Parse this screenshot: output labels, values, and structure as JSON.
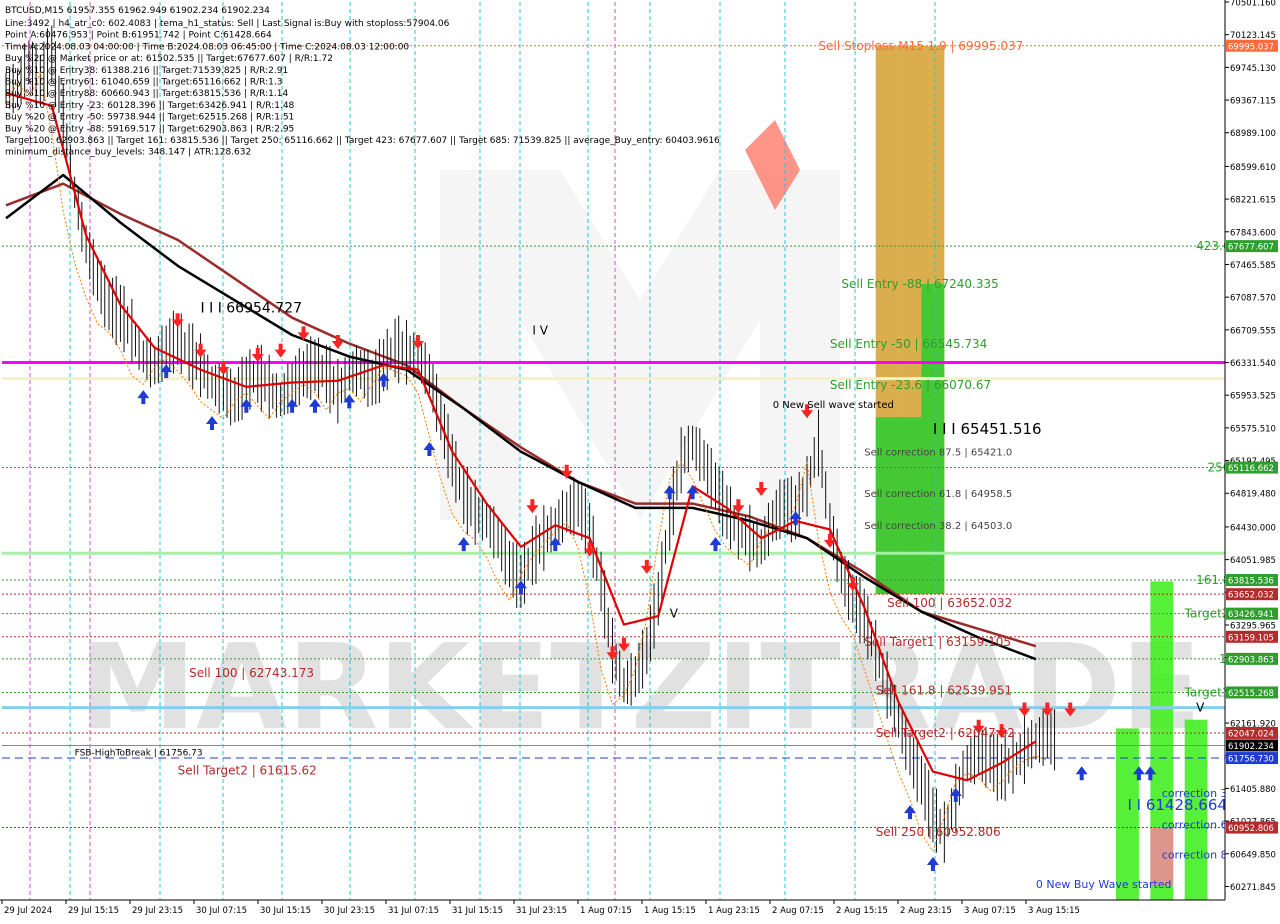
{
  "chart_data": {
    "type": "line",
    "title": "BTCUSD,M15  61957.355 61962.949 61902.234 61902.234",
    "ylim": [
      60115,
      70501.16
    ],
    "info_lines": [
      "Line:3492 | h4_atr_c0: 602.4083 | tema_h1_status: Sell | Last Signal is:Buy with stoploss:57904.06",
      "Point A:60476.953 | Point B:61951.742 | Point C:61428.664",
      "Time A:2024.08.03 04:00:00 | Time B:2024.08.03 06:45:00 | Time C:2024.08.03 12:00:00",
      "Buy %20 @ Market price or at: 61502.535 || Target:67677.607 | R/R:1.72",
      "Buy %10 @ Entry38: 61388.216 || Target:71539.825 | R/R:2.91",
      "Buy %10 @ Entry61: 61040.659 || Target:65116.662 | R/R:1.3",
      "Buy %10 @ Entry88: 60660.943 || Target:63815.536 | R/R:1.14",
      "Buy %10 @ Entry -23: 60128.396 || Target:63426.941 | R/R:1.48",
      "Buy %20 @ Entry -50: 59738.944 || Target:62515.268 | R/R:1.51",
      "Buy %20 @ Entry -88: 59169.517 || Target:62903.863 | R/R:2.95",
      "Target100: 62903.863 || Target 161: 63815.536 || Target 250: 65116.662 || Target 423: 67677.607 || Target 685: 71539.825 || average_Buy_entry: 60403.9616",
      "minimum_distance_buy_levels: 348.147 | ATR:128.632"
    ],
    "y_ticks": [
      "70501.160",
      "70123.145",
      "69745.130",
      "69367.115",
      "68989.100",
      "68599.610",
      "68221.615",
      "67843.600",
      "67465.585",
      "67087.570",
      "66709.555",
      "66331.540",
      "65953.525",
      "65575.510",
      "65197.495",
      "64819.480",
      "64430.000",
      "64051.985",
      "63673.970",
      "63295.965",
      "62917.940",
      "62539.925",
      "62161.920",
      "61783.895",
      "61405.880",
      "61027.865",
      "60649.850",
      "60271.845"
    ],
    "x_ticks": [
      "29 Jul 2024",
      "29 Jul 15:15",
      "29 Jul 23:15",
      "30 Jul 07:15",
      "30 Jul 15:15",
      "30 Jul 23:15",
      "31 Jul 07:15",
      "31 Jul 15:15",
      "31 Jul 23:15",
      "1 Aug 07:15",
      "1 Aug 15:15",
      "1 Aug 23:15",
      "2 Aug 07:15",
      "2 Aug 15:15",
      "2 Aug 23:15",
      "3 Aug 07:15",
      "3 Aug 15:15"
    ],
    "price_series": [
      [
        0,
        69500
      ],
      [
        1,
        69800
      ],
      [
        2,
        69600
      ],
      [
        3,
        69900
      ],
      [
        4,
        69200
      ],
      [
        5,
        68300
      ],
      [
        6,
        67700
      ],
      [
        7,
        67300
      ],
      [
        8,
        67000
      ],
      [
        9,
        66900
      ],
      [
        10,
        66700
      ],
      [
        11,
        66400
      ],
      [
        12,
        66300
      ],
      [
        13,
        66500
      ],
      [
        14,
        66600
      ],
      [
        15,
        66450
      ],
      [
        16,
        66300
      ],
      [
        17,
        66100
      ],
      [
        18,
        66000
      ],
      [
        19,
        65900
      ],
      [
        20,
        66100
      ],
      [
        21,
        66200
      ],
      [
        22,
        66050
      ],
      [
        23,
        65900
      ],
      [
        24,
        66100
      ],
      [
        25,
        66200
      ],
      [
        26,
        66300
      ],
      [
        27,
        66200
      ],
      [
        28,
        66000
      ],
      [
        29,
        66200
      ],
      [
        30,
        66250
      ],
      [
        31,
        66100
      ],
      [
        32,
        66300
      ],
      [
        33,
        66500
      ],
      [
        34,
        66450
      ],
      [
        35,
        66400
      ],
      [
        36,
        66200
      ],
      [
        37,
        65700
      ],
      [
        38,
        65200
      ],
      [
        39,
        64800
      ],
      [
        40,
        64600
      ],
      [
        41,
        64500
      ],
      [
        42,
        64300
      ],
      [
        43,
        64000
      ],
      [
        44,
        63800
      ],
      [
        45,
        64100
      ],
      [
        46,
        64300
      ],
      [
        47,
        64450
      ],
      [
        48,
        64600
      ],
      [
        49,
        64700
      ],
      [
        50,
        64400
      ],
      [
        51,
        63800
      ],
      [
        52,
        63000
      ],
      [
        53,
        62600
      ],
      [
        54,
        62700
      ],
      [
        55,
        63000
      ],
      [
        56,
        63600
      ],
      [
        57,
        64500
      ],
      [
        58,
        65200
      ],
      [
        59,
        65400
      ],
      [
        60,
        65200
      ],
      [
        61,
        64900
      ],
      [
        62,
        64600
      ],
      [
        63,
        64400
      ],
      [
        64,
        64300
      ],
      [
        65,
        64200
      ],
      [
        66,
        64500
      ],
      [
        67,
        64700
      ],
      [
        68,
        64600
      ],
      [
        69,
        64900
      ],
      [
        70,
        65400
      ],
      [
        71,
        64500
      ],
      [
        72,
        63900
      ],
      [
        73,
        63600
      ],
      [
        74,
        63400
      ],
      [
        75,
        63000
      ],
      [
        76,
        62600
      ],
      [
        77,
        62200
      ],
      [
        78,
        61800
      ],
      [
        79,
        61500
      ],
      [
        80,
        61100
      ],
      [
        81,
        60900
      ],
      [
        82,
        61300
      ],
      [
        83,
        61700
      ],
      [
        84,
        61800
      ],
      [
        85,
        61750
      ],
      [
        86,
        61600
      ],
      [
        87,
        61700
      ],
      [
        88,
        61850
      ],
      [
        89,
        61950
      ],
      [
        90,
        62000
      ],
      [
        91,
        61950
      ]
    ],
    "ma_fast": [
      [
        0,
        69450
      ],
      [
        4,
        69300
      ],
      [
        7,
        67800
      ],
      [
        10,
        67000
      ],
      [
        13,
        66500
      ],
      [
        17,
        66250
      ],
      [
        21,
        66050
      ],
      [
        25,
        66100
      ],
      [
        29,
        66120
      ],
      [
        33,
        66300
      ],
      [
        36,
        66250
      ],
      [
        39,
        65300
      ],
      [
        42,
        64700
      ],
      [
        45,
        64200
      ],
      [
        48,
        64450
      ],
      [
        51,
        64300
      ],
      [
        54,
        63300
      ],
      [
        57,
        63400
      ],
      [
        60,
        64900
      ],
      [
        63,
        64650
      ],
      [
        66,
        64300
      ],
      [
        69,
        64500
      ],
      [
        72,
        64400
      ],
      [
        75,
        63500
      ],
      [
        78,
        62400
      ],
      [
        81,
        61600
      ],
      [
        84,
        61500
      ],
      [
        87,
        61700
      ],
      [
        90,
        61950
      ]
    ],
    "ma_mid": [
      [
        0,
        68150
      ],
      [
        5,
        68400
      ],
      [
        10,
        68050
      ],
      [
        15,
        67750
      ],
      [
        20,
        67300
      ],
      [
        25,
        66850
      ],
      [
        30,
        66550
      ],
      [
        35,
        66300
      ],
      [
        40,
        65800
      ],
      [
        45,
        65350
      ],
      [
        50,
        64950
      ],
      [
        55,
        64700
      ],
      [
        60,
        64700
      ],
      [
        65,
        64550
      ],
      [
        70,
        64300
      ],
      [
        75,
        63900
      ],
      [
        80,
        63450
      ],
      [
        85,
        63250
      ],
      [
        90,
        63050
      ]
    ],
    "ma_slow": [
      [
        0,
        68000
      ],
      [
        5,
        68500
      ],
      [
        10,
        67950
      ],
      [
        15,
        67450
      ],
      [
        20,
        67050
      ],
      [
        25,
        66650
      ],
      [
        30,
        66400
      ],
      [
        35,
        66250
      ],
      [
        40,
        65800
      ],
      [
        45,
        65300
      ],
      [
        50,
        64950
      ],
      [
        55,
        64650
      ],
      [
        60,
        64650
      ],
      [
        65,
        64500
      ],
      [
        70,
        64300
      ],
      [
        75,
        63850
      ],
      [
        80,
        63450
      ],
      [
        85,
        63150
      ],
      [
        90,
        62900
      ]
    ],
    "horizontal_levels": [
      {
        "price": 69995.037,
        "label": "69995.037",
        "bg": "#ff6a3d",
        "style": "dotted",
        "color": "#ff6a3d"
      },
      {
        "price": 67677.607,
        "label": "67677.607",
        "bg": "#2e9e2e",
        "style": "dotted",
        "color": "#2e9e2e"
      },
      {
        "price": 66331.54,
        "label": "",
        "bg": "",
        "style": "solid",
        "color": "#ff00ff",
        "width": 3
      },
      {
        "price": 66145.0,
        "label": "",
        "bg": "",
        "style": "solid",
        "color": "#f3f0cc",
        "width": 3
      },
      {
        "price": 65116.662,
        "label": "65116.662",
        "bg": "#2e9e2e",
        "style": "dotted",
        "color": "#2e9e2e"
      },
      {
        "price": 64125.0,
        "label": "",
        "bg": "",
        "style": "solid",
        "color": "#a5f0a5",
        "width": 3
      },
      {
        "price": 63815.536,
        "label": "63815.536",
        "bg": "#2e9e2e",
        "style": "dotted",
        "color": "#2e9e2e"
      },
      {
        "price": 63652.032,
        "label": "63652.032",
        "bg": "#b52a2a",
        "style": "dotted",
        "color": "#b52a2a"
      },
      {
        "price": 63426.941,
        "label": "63426.941",
        "bg": "#2e9e2e",
        "style": "dotted",
        "color": "#2e9e2e"
      },
      {
        "price": 63159.105,
        "label": "63159.105",
        "bg": "#b52a2a",
        "style": "dotted",
        "color": "#b52a2a"
      },
      {
        "price": 62903.863,
        "label": "62903.863",
        "bg": "#2e9e2e",
        "style": "dotted",
        "color": "#2e9e2e"
      },
      {
        "price": 62515.268,
        "label": "62515.268",
        "bg": "#2e9e2e",
        "style": "dotted",
        "color": "#2e9e2e"
      },
      {
        "price": 62340.0,
        "label": "",
        "bg": "",
        "style": "solid",
        "color": "#87ceeb",
        "width": 3
      },
      {
        "price": 62047.024,
        "label": "62047.024",
        "bg": "#b52a2a",
        "style": "dotted",
        "color": "#b52a2a"
      },
      {
        "price": 61902.234,
        "label": "61902.234",
        "bg": "#000000",
        "style": "solid",
        "color": "#888888"
      },
      {
        "price": 61756.73,
        "label": "61756.730",
        "bg": "#1f3bd6",
        "style": "dashed",
        "color": "#1f3bd6"
      },
      {
        "price": 60952.806,
        "label": "60952.806",
        "bg": "#b52a2a",
        "style": "dotted",
        "color": "#b52a2a"
      }
    ],
    "zones": [
      {
        "x0": 76,
        "x1": 78,
        "p0": 63652,
        "p1": 69995,
        "color": "#d6a43a"
      },
      {
        "x0": 78,
        "x1": 80,
        "p0": 63652,
        "p1": 69995,
        "color": "#d6a43a"
      },
      {
        "x0": 80,
        "x1": 82,
        "p0": 63652,
        "p1": 69995,
        "color": "#d6a43a"
      },
      {
        "x0": 76,
        "x1": 78,
        "p0": 63652,
        "p1": 65700,
        "color": "#33cc33"
      },
      {
        "x0": 78,
        "x1": 80,
        "p0": 63652,
        "p1": 65700,
        "color": "#33cc33"
      },
      {
        "x0": 80,
        "x1": 82,
        "p0": 63652,
        "p1": 67240,
        "color": "#33cc33"
      },
      {
        "x0": 97,
        "x1": 99,
        "p0": 60120,
        "p1": 62100,
        "color": "#44ee22"
      },
      {
        "x0": 100,
        "x1": 102,
        "p0": 60120,
        "p1": 63800,
        "color": "#44ee22"
      },
      {
        "x0": 103,
        "x1": 105,
        "p0": 60120,
        "p1": 62200,
        "color": "#44ee22"
      }
    ],
    "annotations": [
      {
        "text": "Sell Stoploss M15 1.9 | 69995.037",
        "price": 69995,
        "x": 71,
        "color": "#ff6a3d",
        "size": 12
      },
      {
        "text": "423.6",
        "price": 67677,
        "x": 104,
        "color": "#2e9e2e",
        "size": 12
      },
      {
        "text": "Sell Entry -88 | 67240.335",
        "price": 67240,
        "x": 73,
        "color": "#2e9e2e",
        "size": 12
      },
      {
        "text": "I I I 66954.727",
        "price": 66954,
        "x": 17,
        "color": "#000000",
        "size": 14
      },
      {
        "text": "I V",
        "price": 66700,
        "x": 46,
        "color": "#000000",
        "size": 12
      },
      {
        "text": "Sell Entry -50 | 66545.734",
        "price": 66545,
        "x": 72,
        "color": "#2e9e2e",
        "size": 12
      },
      {
        "text": "Sell Entry -23.6 | 66070.67",
        "price": 66070,
        "x": 72,
        "color": "#2e9e2e",
        "size": 12
      },
      {
        "text": "0 New Sell wave started",
        "price": 65850,
        "x": 67,
        "color": "#000000",
        "size": 10
      },
      {
        "text": "I I I 65451.516",
        "price": 65550,
        "x": 81,
        "color": "#000000",
        "size": 15
      },
      {
        "text": "Sell correction 87.5 | 65421.0",
        "price": 65300,
        "x": 75,
        "color": "#444444",
        "size": 10
      },
      {
        "text": "250",
        "price": 65116,
        "x": 105,
        "color": "#2e9e2e",
        "size": 12
      },
      {
        "text": "Sell correction 61.8 | 64958.5",
        "price": 64820,
        "x": 75,
        "color": "#444444",
        "size": 10
      },
      {
        "text": "Sell correction 38.2 | 64503.0",
        "price": 64450,
        "x": 75,
        "color": "#444444",
        "size": 10
      },
      {
        "text": "161.8",
        "price": 63815,
        "x": 104,
        "color": "#2e9e2e",
        "size": 12
      },
      {
        "text": "V",
        "price": 63426,
        "x": 58,
        "color": "#000000",
        "size": 12
      },
      {
        "text": "Sell 100 | 63652.032",
        "price": 63550,
        "x": 77,
        "color": "#b52a2a",
        "size": 12
      },
      {
        "text": "Target2",
        "price": 63426,
        "x": 103,
        "color": "#2e9e2e",
        "size": 12
      },
      {
        "text": "Sell Target1 | 63159.105",
        "price": 63100,
        "x": 75,
        "color": "#b52a2a",
        "size": 12
      },
      {
        "text": "100",
        "price": 62903,
        "x": 106,
        "color": "#2e9e2e",
        "size": 12
      },
      {
        "text": "Sell 100 | 62743.173",
        "price": 62743,
        "x": 16,
        "color": "#b52a2a",
        "size": 12
      },
      {
        "text": "Sell 161.8 | 62539.951",
        "price": 62539,
        "x": 76,
        "color": "#b52a2a",
        "size": 12
      },
      {
        "text": "Target1",
        "price": 62515,
        "x": 103,
        "color": "#2e9e2e",
        "size": 12
      },
      {
        "text": "V",
        "price": 62340,
        "x": 104,
        "color": "#000000",
        "size": 12
      },
      {
        "text": "Sell Target2 | 62047.02",
        "price": 62047,
        "x": 76,
        "color": "#b52a2a",
        "size": 12
      },
      {
        "text": "FSB-HighToBreak | 61756.73",
        "price": 61835,
        "x": 6,
        "color": "#000000",
        "size": 9
      },
      {
        "text": "Sell Target2 | 61615.62",
        "price": 61615,
        "x": 15,
        "color": "#b52a2a",
        "size": 12
      },
      {
        "text": "correction 38.2",
        "price": 61350,
        "x": 101,
        "color": "#1f3bd6",
        "size": 11
      },
      {
        "text": "I I 61428.664",
        "price": 61200,
        "x": 98,
        "color": "#1f3bd6",
        "size": 15
      },
      {
        "text": "correction 61.8",
        "price": 60990,
        "x": 101,
        "color": "#1f3bd6",
        "size": 11
      },
      {
        "text": "Sell  250 | 60952.806",
        "price": 60900,
        "x": 76,
        "color": "#b52a2a",
        "size": 12
      },
      {
        "text": "correction 87.5",
        "price": 60640,
        "x": 101,
        "color": "#1f3bd6",
        "size": 11
      },
      {
        "text": "0 New Buy Wave started",
        "price": 60300,
        "x": 90,
        "color": "#1f3bd6",
        "size": 11
      }
    ],
    "watermark": "MARKETZITRADE",
    "colors": {
      "up_arrow": "#1f3bd6",
      "down_arrow": "#ff2222",
      "ma_fast": "#e00000",
      "ma_mid": "#9b2a2a",
      "ma_slow": "#000000"
    }
  }
}
